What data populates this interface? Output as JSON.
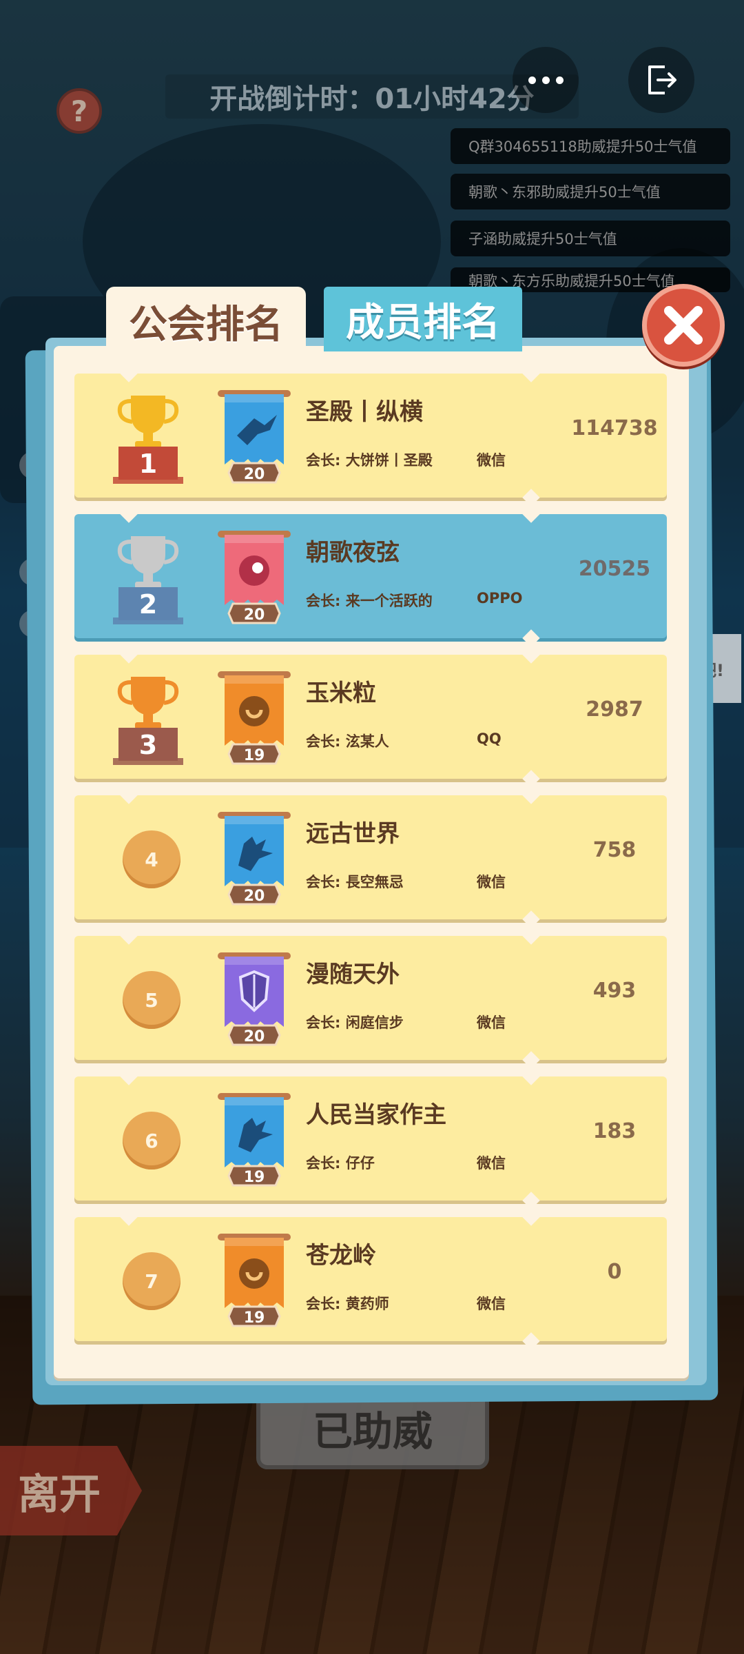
{
  "top": {
    "countdown": "开战倒计时：01小时42分",
    "help": "?"
  },
  "messages": [
    "Q群304655118助威提升50士气值",
    "朝歌丶东邪助威提升50士气值",
    "子涵助威提升50士气值",
    "朝歌丶东方乐助威提升50士气值"
  ],
  "side_bubble": "吧!",
  "tabs": {
    "guild": "公会排名",
    "member": "成员排名"
  },
  "rows": [
    {
      "rank": "1",
      "level": "20",
      "name": "圣殿丨纵横",
      "leader": "会长: 大饼饼丨圣殿",
      "platform": "微信",
      "score": "114738",
      "emblem": "dragon-emblem-icon",
      "emblem_color": "#3a9fe0",
      "trophy": "gold-trophy-icon"
    },
    {
      "rank": "2",
      "level": "20",
      "name": "朝歌夜弦",
      "leader": "会长: 来一个活跃的",
      "platform": "OPPO",
      "score": "20525",
      "emblem": "swirl-emblem-icon",
      "emblem_color": "#ee6a7a",
      "trophy": "silver-trophy-icon"
    },
    {
      "rank": "3",
      "level": "19",
      "name": "玉米粒",
      "leader": "会长: 泫某人",
      "platform": "QQ",
      "score": "2987",
      "emblem": "coin-emblem-icon",
      "emblem_color": "#f08c2a",
      "trophy": "bronze-trophy-icon"
    },
    {
      "rank": "4",
      "level": "20",
      "name": "远古世界",
      "leader": "会长: 長空無忌",
      "platform": "微信",
      "score": "758",
      "emblem": "wolf-emblem-icon",
      "emblem_color": "#3a9fe0"
    },
    {
      "rank": "5",
      "level": "20",
      "name": "漫随天外",
      "leader": "会长: 闲庭信步",
      "platform": "微信",
      "score": "493",
      "emblem": "shield-emblem-icon",
      "emblem_color": "#8a6ae0"
    },
    {
      "rank": "6",
      "level": "19",
      "name": "人民当家作主",
      "leader": "会长: 仔仔",
      "platform": "微信",
      "score": "183",
      "emblem": "wolf-emblem-icon",
      "emblem_color": "#3a9fe0"
    },
    {
      "rank": "7",
      "level": "19",
      "name": "苍龙岭",
      "leader": "会长: 黄药师",
      "platform": "微信",
      "score": "0",
      "emblem": "coin-emblem-icon",
      "emblem_color": "#f08c2a"
    }
  ],
  "bottom": {
    "assist": "已助威",
    "leave": "离开"
  }
}
